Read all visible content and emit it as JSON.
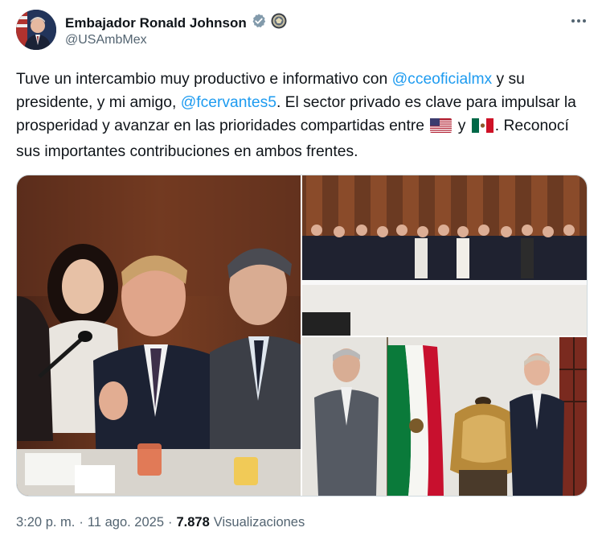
{
  "author": {
    "name": "Embajador Ronald Johnson",
    "handle": "@USAmbMex",
    "verified": true,
    "verified_color": "#829aab"
  },
  "tweet": {
    "part1": "Tuve un intercambio muy productivo e informativo con ",
    "mention1": "@cceoficialmx",
    "part2": " y su presidente, y mi amigo, ",
    "mention2": "@fcervantes5",
    "part3": ". El sector privado es clave para impulsar la prosperidad y avanzar en las prioridades compartidas entre ",
    "flag1": "us-flag",
    "part4": " y ",
    "flag2": "mx-flag",
    "part5": ". Reconocí sus importantes contribuciones en ambos frentes."
  },
  "media": {
    "photos": [
      {
        "name": "photo-meeting-speech",
        "icon": "meeting-photo"
      },
      {
        "name": "photo-group-picture",
        "icon": "group-photo"
      },
      {
        "name": "photo-flag-saddle",
        "icon": "flag-saddle-photo"
      }
    ]
  },
  "meta": {
    "time": "3:20 p. m.",
    "date": "11 ago. 2025",
    "views_count": "7.878",
    "views_label": "Visualizaciones",
    "separator": "·"
  },
  "colors": {
    "link": "#1d9bf0",
    "secondary": "#536471",
    "border": "#cfd9de"
  }
}
